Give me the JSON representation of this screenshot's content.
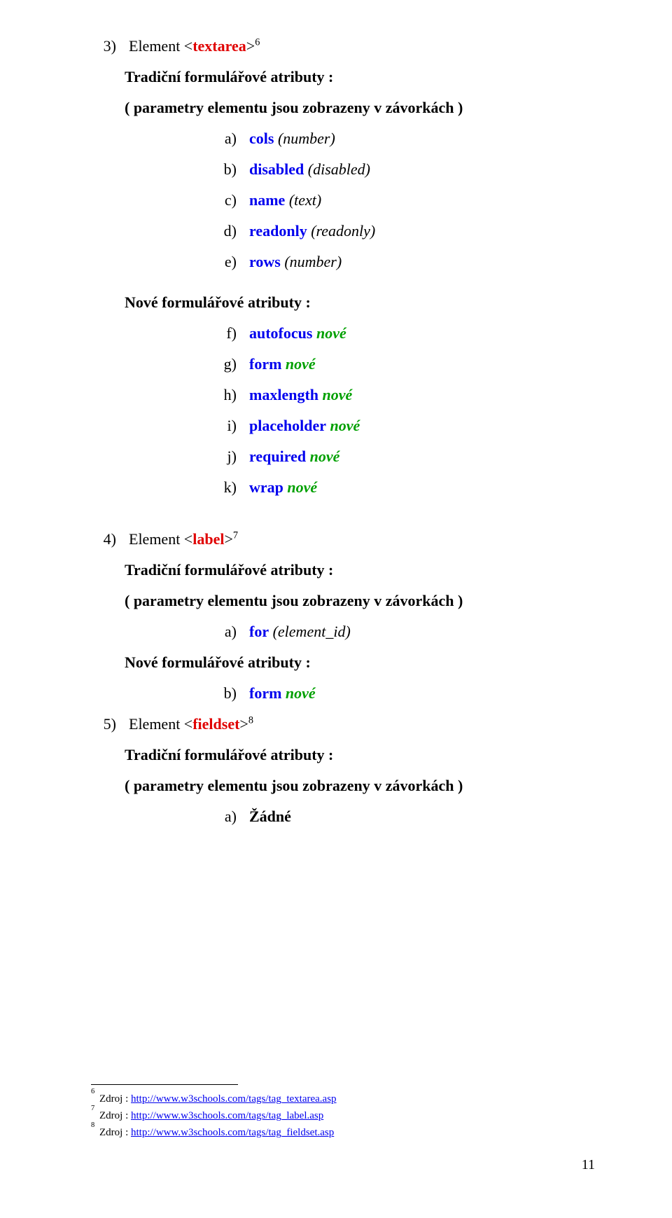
{
  "section3": {
    "bullet": "3)",
    "t1": "Element <",
    "t2": "textarea",
    "t3": ">",
    "supref": "6",
    "trad_title": "Tradiční formulářové atributy :",
    "paren": "( parametry elementu jsou zobrazeny v závorkách )",
    "items": [
      {
        "b": "a)",
        "name": "cols",
        "note": "(number)"
      },
      {
        "b": "b)",
        "name": "disabled",
        "note": "(disabled)"
      },
      {
        "b": "c)",
        "name": "name",
        "note": "(text)"
      },
      {
        "b": "d)",
        "name": "readonly",
        "note": "(readonly)"
      },
      {
        "b": "e)",
        "name": "rows",
        "note": "(number)"
      }
    ],
    "nove_title": "Nové formulářové atributy :",
    "nove_items": [
      {
        "b": "f)",
        "name": "autofocus",
        "note": "nové"
      },
      {
        "b": "g)",
        "name": "form",
        "note": "nové"
      },
      {
        "b": "h)",
        "name": "maxlength",
        "note": "nové"
      },
      {
        "b": "i)",
        "name": "placeholder",
        "note": "nové"
      },
      {
        "b": "j)",
        "name": "required",
        "note": "nové"
      },
      {
        "b": "k)",
        "name": "wrap",
        "note": "nové"
      }
    ]
  },
  "section4": {
    "bullet": "4)",
    "t1": "Element <",
    "t2": "label",
    "t3": ">",
    "supref": "7",
    "trad_title": "Tradiční formulářové atributy :",
    "paren": "( parametry elementu jsou zobrazeny v závorkách )",
    "items": [
      {
        "b": "a)",
        "name": "for",
        "note": "(element_id)"
      }
    ],
    "nove_title": "Nové formulářové atributy :",
    "nove_items": [
      {
        "b": "b)",
        "name": "form",
        "note": "nové"
      }
    ]
  },
  "section5": {
    "bullet": "5)",
    "t1": "Element <",
    "t2": "fieldset",
    "t3": ">",
    "supref": "8",
    "trad_title": "Tradiční formulářové atributy :",
    "paren": "( parametry elementu jsou zobrazeny v závorkách )",
    "items": [
      {
        "b": "a)",
        "name": "Žádné",
        "note": ""
      }
    ]
  },
  "footnotes": [
    {
      "num": "6",
      "prefix": " Zdroj : ",
      "url": "http://www.w3schools.com/tags/tag_textarea.asp"
    },
    {
      "num": "7",
      "prefix": " Zdroj : ",
      "url": "http://www.w3schools.com/tags/tag_label.asp"
    },
    {
      "num": "8",
      "prefix": " Zdroj : ",
      "url": "http://www.w3schools.com/tags/tag_fieldset.asp"
    }
  ],
  "page_number": "11"
}
